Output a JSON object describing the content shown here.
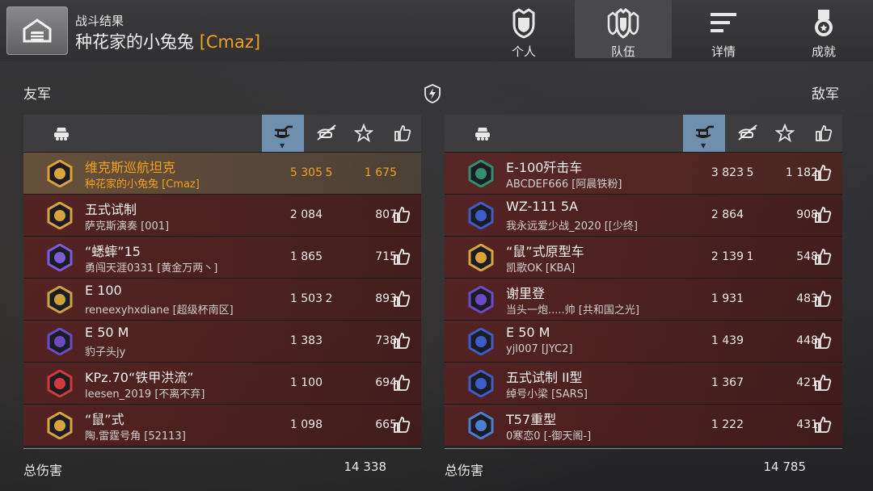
{
  "header": {
    "subtitle": "战斗结果",
    "player_name": "种花家的小兔兔",
    "player_clan": "[Cmaz]"
  },
  "tabs": [
    {
      "label": "个人",
      "icon": "helmet-icon",
      "active": false
    },
    {
      "label": "队伍",
      "icon": "team-icon",
      "active": true
    },
    {
      "label": "详情",
      "icon": "details-icon",
      "active": false
    },
    {
      "label": "成就",
      "icon": "medal-icon",
      "active": false
    }
  ],
  "allies": {
    "title": "友军",
    "total_label": "总伤害",
    "total_damage": "14 338",
    "rows": [
      {
        "tank": "维克斯巡航坦克",
        "player": "种花家的小兔兔 [Cmaz]",
        "damage": "5 305",
        "kills": "5",
        "xp": "1 675",
        "me": true,
        "badge_color": "#d9a23a"
      },
      {
        "tank": "五式试制",
        "player": "萨克斯演奏 [001]",
        "damage": "2 084",
        "kills": "",
        "xp": "807",
        "badge_color": "#d9a23a"
      },
      {
        "tank": "“蟋蟀”15",
        "player": "勇闯天涯0331 [黄金万两丶]",
        "damage": "1 865",
        "kills": "",
        "xp": "715",
        "badge_color": "#7d5bd6"
      },
      {
        "tank": "E 100",
        "player": "reneexyhxdiane [超级杯南区]",
        "damage": "1 503",
        "kills": "2",
        "xp": "893",
        "badge_color": "#c9a43a"
      },
      {
        "tank": "E 50 M",
        "player": "豹子头jy",
        "damage": "1 383",
        "kills": "",
        "xp": "738",
        "badge_color": "#6b4bc4"
      },
      {
        "tank": "KPz.70“铁甲洪流”",
        "player": "leesen_2019 [不离不弃]",
        "damage": "1 100",
        "kills": "",
        "xp": "694",
        "badge_color": "#d23a3a"
      },
      {
        "tank": "“鼠”式",
        "player": "陶.雷霆号角 [52113]",
        "damage": "1 098",
        "kills": "",
        "xp": "665",
        "badge_color": "#d9a23a"
      }
    ]
  },
  "enemies": {
    "title": "敌军",
    "total_label": "总伤害",
    "total_damage": "14 785",
    "rows": [
      {
        "tank": "E-100歼击车",
        "player": "ABCDEF666 [阿晨铁粉]",
        "damage": "3 823",
        "kills": "5",
        "xp": "1 182",
        "badge_color": "#2f8f6f"
      },
      {
        "tank": "WZ-111 5A",
        "player": "我永远爱少战_2020 [[少终]",
        "damage": "2 864",
        "kills": "",
        "xp": "908",
        "badge_color": "#3e5bc9"
      },
      {
        "tank": "“鼠”式原型车",
        "player": "凯歌OK [KBA]",
        "damage": "2 139",
        "kills": "1",
        "xp": "548",
        "badge_color": "#d9a23a"
      },
      {
        "tank": "谢里登",
        "player": "当头一炮.....帅 [共和国之光]",
        "damage": "1 931",
        "kills": "",
        "xp": "483",
        "badge_color": "#6b4bc4"
      },
      {
        "tank": "E 50 M",
        "player": "yjl007 [JYC2]",
        "damage": "1 439",
        "kills": "",
        "xp": "448",
        "badge_color": "#3e5bc9"
      },
      {
        "tank": "五式试制 II型",
        "player": "绰号小梁 [SARS]",
        "damage": "1 367",
        "kills": "",
        "xp": "421",
        "badge_color": "#3e5bc9"
      },
      {
        "tank": "T57重型",
        "player": "0寒恋0 [-御天阁-]",
        "damage": "1 222",
        "kills": "",
        "xp": "431",
        "badge_color": "#4a7fd0"
      }
    ]
  }
}
